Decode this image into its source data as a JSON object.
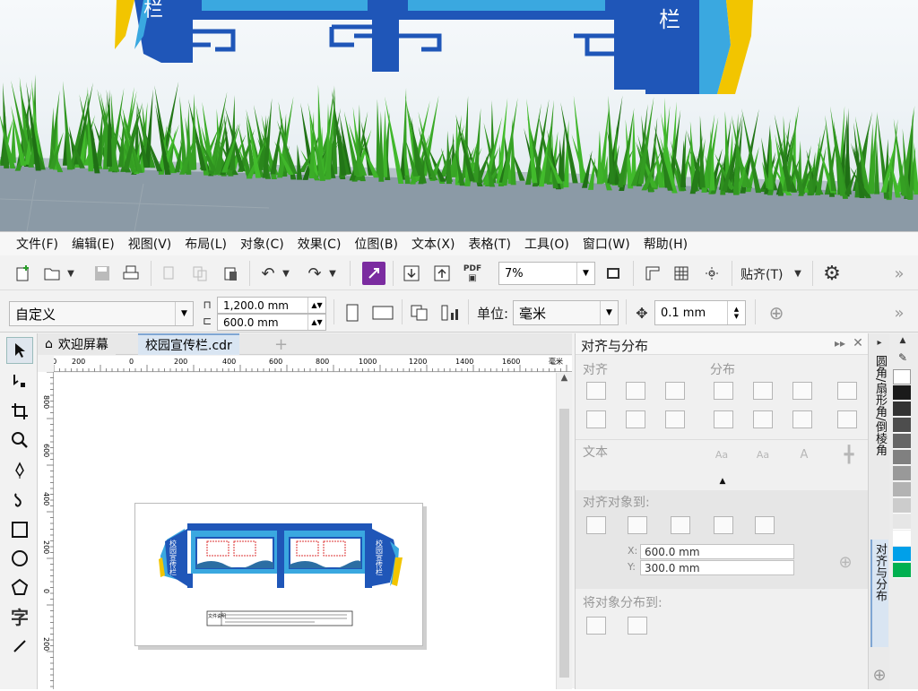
{
  "menu": [
    "文件(F)",
    "编辑(E)",
    "视图(V)",
    "布局(L)",
    "对象(C)",
    "效果(C)",
    "位图(B)",
    "文本(X)",
    "表格(T)",
    "工具(O)",
    "窗口(W)",
    "帮助(H)"
  ],
  "toolbar": {
    "zoom_value": "7%",
    "snap_label": "贴齐(T)",
    "pdf_label": "PDF"
  },
  "property_bar": {
    "preset": "自定义",
    "width": "1,200.0 mm",
    "height": "600.0 mm",
    "units_label": "单位:",
    "units_value": "毫米",
    "nudge": "0.1 mm"
  },
  "tabs": {
    "welcome": "欢迎屏幕",
    "document": "校园宣传栏.cdr"
  },
  "ruler": {
    "h_ticks": [
      "200",
      "0",
      "200",
      "400",
      "600",
      "800",
      "1000",
      "1200",
      "1400",
      "1600"
    ],
    "h_unit": "毫米",
    "v_ticks": [
      "800",
      "600",
      "400",
      "200",
      "0",
      "200"
    ]
  },
  "page_content": {
    "board_title": "校园宣传栏",
    "title_block_label": "文件说明"
  },
  "docker": {
    "title": "对齐与分布",
    "align_section": "对齐",
    "distribute_section": "分布",
    "text_section": "文本",
    "align_to_label": "对齐对象到:",
    "x_label": "X:",
    "x_value": "600.0 mm",
    "y_label": "Y:",
    "y_value": "300.0 mm",
    "distribute_to_label": "将对象分布到:"
  },
  "side_tabs": {
    "corner": "圆角/扇形角/倒棱角",
    "align": "对齐与分布"
  },
  "scene": {
    "sign_char": "栏"
  },
  "colors": {
    "accent_blue": "#1f56b8",
    "board_light_blue": "#3aa8e0",
    "board_yellow": "#f2c500",
    "grass": "#3f8f2a",
    "palette": [
      "#ffffff",
      "#1a1a1a",
      "#333333",
      "#4d4d4d",
      "#666666",
      "#808080",
      "#999999",
      "#b3b3b3",
      "#cccccc",
      "#e6e6e6",
      "#ffffff",
      "#00a0e9",
      "#00b050"
    ]
  }
}
